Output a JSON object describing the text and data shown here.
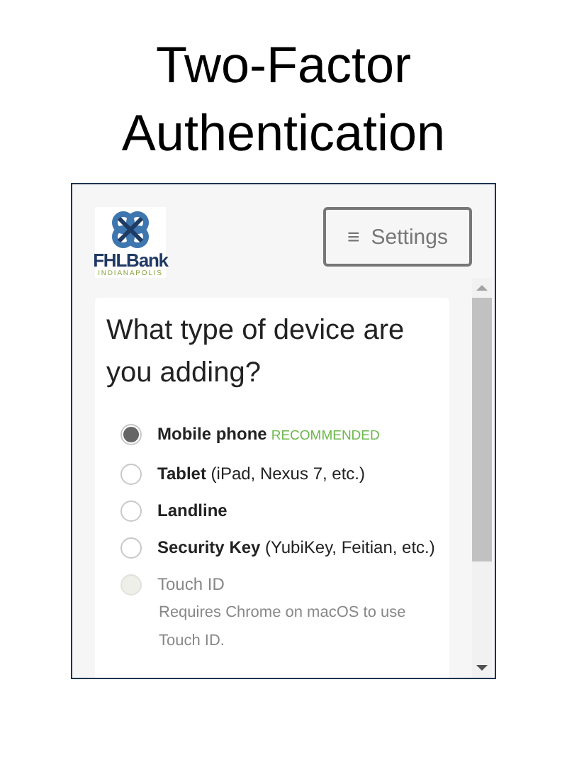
{
  "page_title": "Two-Factor Authentication",
  "logo": {
    "name": "FHLBank",
    "tagline": "INDIANAPOLIS"
  },
  "settings_button": {
    "icon": "≡",
    "label": "Settings"
  },
  "question": "What type of device are you adding?",
  "options": [
    {
      "label": "**Mobile phone**",
      "badge": "RECOMMENDED",
      "selected": true,
      "disabled": false
    },
    {
      "label": "**Tablet** (iPad, Nexus 7, etc.)",
      "selected": false,
      "disabled": false
    },
    {
      "label": "**Landline**",
      "selected": false,
      "disabled": false
    },
    {
      "label": "**Security Key** (YubiKey, Feitian, etc.)",
      "selected": false,
      "disabled": false
    },
    {
      "label": "Touch ID",
      "note": "Requires Chrome on macOS to use Touch ID.",
      "selected": false,
      "disabled": true
    }
  ]
}
